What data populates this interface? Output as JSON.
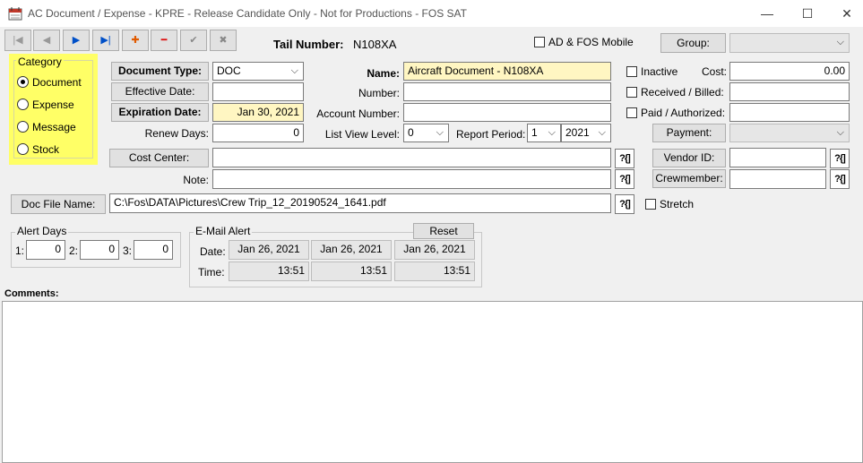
{
  "window": {
    "title": "AC Document / Expense - KPRE - Release Candidate Only - Not for Productions - FOS SAT",
    "minimize": "—",
    "maximize": "☐",
    "close": "✕"
  },
  "toolbar": {
    "first": "|◀",
    "prev": "◀",
    "next": "▶",
    "last": "▶|",
    "add": "✚",
    "remove": "━",
    "save": "✔",
    "cancel": "✖"
  },
  "tail": {
    "label": "Tail Number:",
    "value": "N108XA"
  },
  "ad_fos_mobile": {
    "label": "AD & FOS Mobile",
    "checked": false
  },
  "group": {
    "label": "Group:",
    "value": ""
  },
  "category": {
    "legend": "Category",
    "options": [
      "Document",
      "Expense",
      "Message",
      "Stock"
    ],
    "selected": "Document"
  },
  "document_type": {
    "label": "Document Type:",
    "value": "DOC"
  },
  "effective_date": {
    "label": "Effective Date:",
    "value": ""
  },
  "expiration_date": {
    "label": "Expiration Date:",
    "value": "Jan 30, 2021"
  },
  "renew_days": {
    "label": "Renew Days:",
    "value": "0"
  },
  "name": {
    "label": "Name:",
    "value": "Aircraft Document - N108XA"
  },
  "number": {
    "label": "Number:",
    "value": ""
  },
  "account_number": {
    "label": "Account Number:",
    "value": ""
  },
  "list_view_level": {
    "label": "List View Level:",
    "value": "0"
  },
  "report_period": {
    "label": "Report Period:",
    "month": "1",
    "year": "2021"
  },
  "inactive": {
    "label": "Inactive",
    "checked": false
  },
  "received_billed": {
    "label": "Received  /  Billed:",
    "value": ""
  },
  "paid_authorized": {
    "label": "Paid / Authorized:",
    "value": ""
  },
  "cost": {
    "label": "Cost:",
    "value": "0.00"
  },
  "payment": {
    "label": "Payment:",
    "value": ""
  },
  "cost_center": {
    "label": "Cost Center:",
    "value": ""
  },
  "note": {
    "label": "Note:",
    "value": ""
  },
  "vendor_id": {
    "label": "Vendor ID:",
    "value": ""
  },
  "crewmember": {
    "label": "Crewmember:",
    "value": ""
  },
  "lookup": "?{]",
  "doc_file": {
    "label": "Doc File Name:",
    "value": "C:\\Fos\\DATA\\Pictures\\Crew Trip_12_20190524_1641.pdf"
  },
  "stretch": {
    "label": "Stretch",
    "checked": false
  },
  "alert_days": {
    "legend": "Alert Days",
    "items": [
      {
        "label": "1:",
        "value": "0"
      },
      {
        "label": "2:",
        "value": "0"
      },
      {
        "label": "3:",
        "value": "0"
      }
    ]
  },
  "email_alert": {
    "legend": "E-Mail Alert",
    "reset": "Reset",
    "date_label": "Date:",
    "time_label": "Time:",
    "dates": [
      "Jan 26, 2021",
      "Jan 26, 2021",
      "Jan 26, 2021"
    ],
    "times": [
      "13:51",
      "13:51",
      "13:51"
    ]
  },
  "comments": {
    "label": "Comments:",
    "value": ""
  },
  "colors": {
    "highlight": "#fff6c2",
    "category_bg": "#ffff66",
    "accent": "#0050c8"
  }
}
